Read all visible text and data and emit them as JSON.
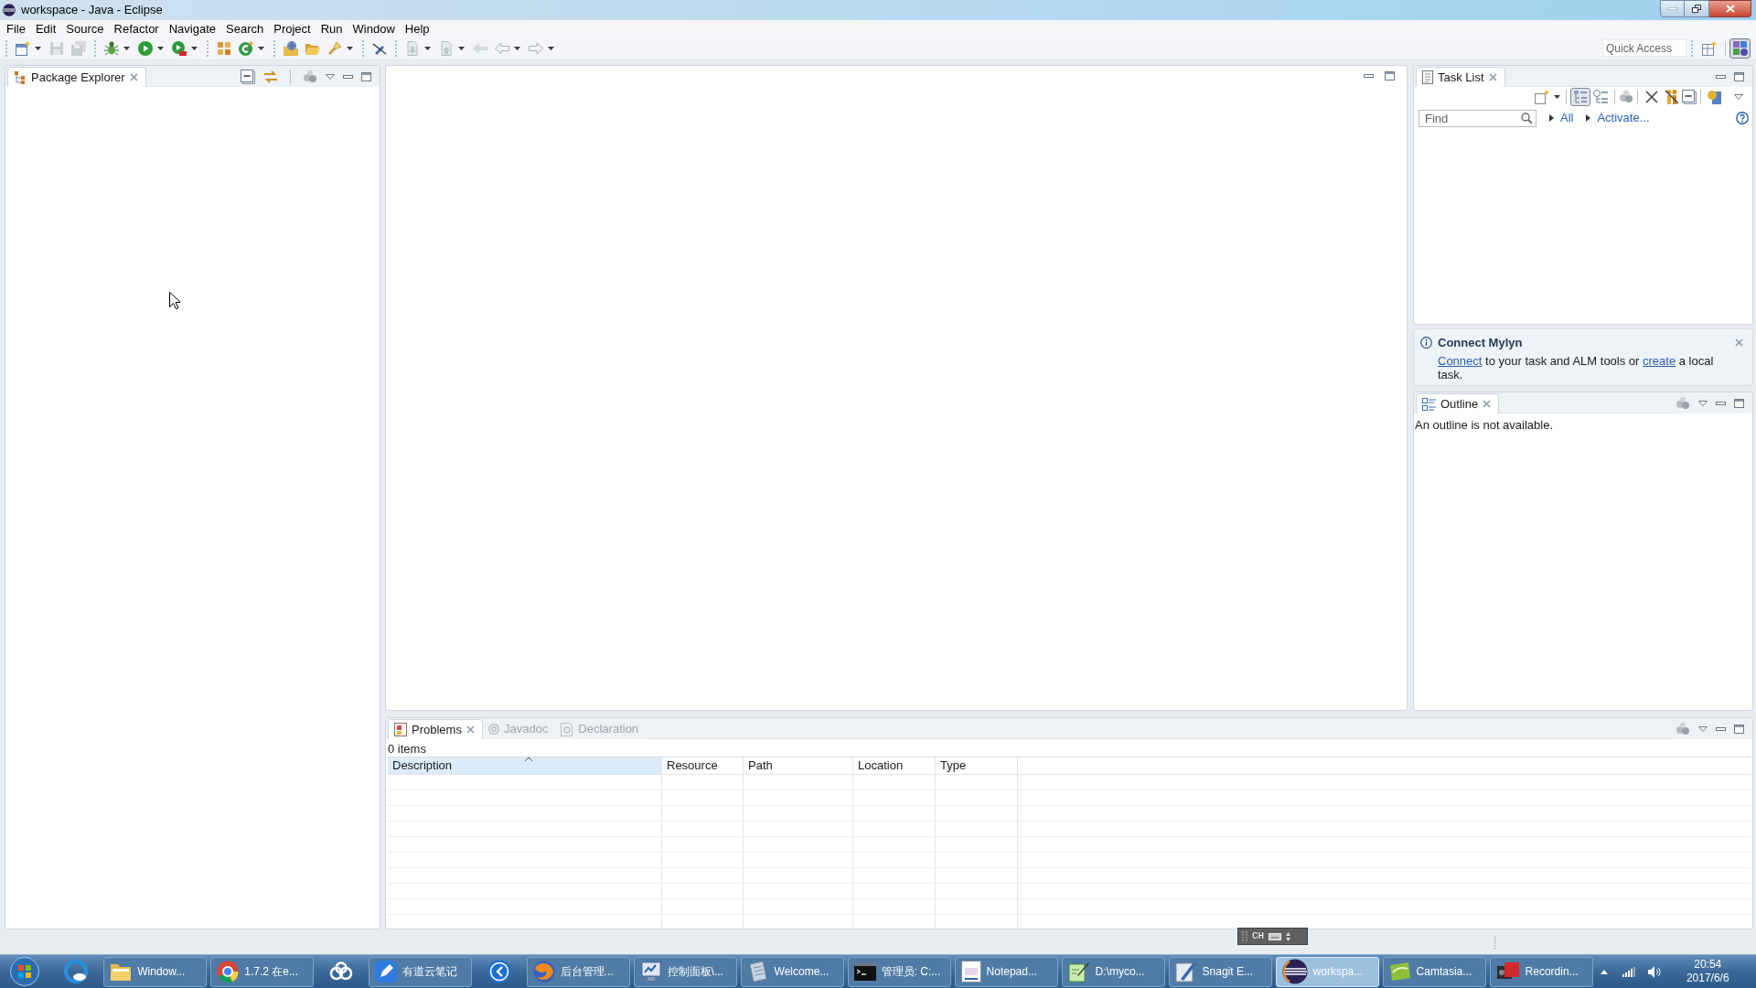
{
  "window": {
    "title": "workspace - Java - Eclipse"
  },
  "menu": [
    "File",
    "Edit",
    "Source",
    "Refactor",
    "Navigate",
    "Search",
    "Project",
    "Run",
    "Window",
    "Help"
  ],
  "quick_access": {
    "placeholder": "Quick Access"
  },
  "package_explorer": {
    "tab": {
      "label": "Package Explorer",
      "selected": true
    }
  },
  "task_list": {
    "tab": {
      "label": "Task List",
      "selected": true
    },
    "find": {
      "placeholder": "Find"
    },
    "filters": [
      "All",
      "Activate..."
    ]
  },
  "connect_mylyn": {
    "title": "Connect Mylyn",
    "message": [
      {
        "kind": "link",
        "text": "Connect"
      },
      {
        "kind": "text",
        "text": " to your task and ALM tools or "
      },
      {
        "kind": "link",
        "text": "create"
      },
      {
        "kind": "text",
        "text": " a local task."
      }
    ]
  },
  "outline": {
    "tab": {
      "label": "Outline",
      "selected": true
    },
    "message": "An outline is not available."
  },
  "bottom_panel": {
    "tabs": [
      {
        "label": "Problems",
        "selected": true
      },
      {
        "label": "Javadoc",
        "selected": false
      },
      {
        "label": "Declaration",
        "selected": false
      }
    ],
    "summary": "0 items",
    "columns": [
      {
        "label": "Description",
        "sorted": true
      },
      {
        "label": "Resource",
        "sorted": false
      },
      {
        "label": "Path",
        "sorted": false
      },
      {
        "label": "Location",
        "sorted": false
      },
      {
        "label": "Type",
        "sorted": false
      }
    ]
  },
  "ime": {
    "label": "CH"
  },
  "taskbar": {
    "items": [
      {
        "kind": "pinned",
        "selected": false
      },
      {
        "kind": "window",
        "label": "Window...",
        "selected": false
      },
      {
        "kind": "window",
        "label": "1.7.2 在e...",
        "selected": false
      },
      {
        "kind": "pinned",
        "selected": false
      },
      {
        "kind": "window",
        "label": "有道云笔记",
        "selected": false
      },
      {
        "kind": "pinned",
        "selected": false
      },
      {
        "kind": "window",
        "label": "后台管理...",
        "selected": false
      },
      {
        "kind": "window",
        "label": "控制面板\\...",
        "selected": false
      },
      {
        "kind": "window",
        "label": "Welcome...",
        "selected": false
      },
      {
        "kind": "window",
        "label": "管理员: C:...",
        "selected": false
      },
      {
        "kind": "window",
        "label": "Notepad...",
        "selected": false
      },
      {
        "kind": "window",
        "label": "D:\\myco...",
        "selected": false
      },
      {
        "kind": "window",
        "label": "Snagit E...",
        "selected": false
      },
      {
        "kind": "window",
        "label": "workspa...",
        "selected": true
      },
      {
        "kind": "window",
        "label": "Camtasia...",
        "selected": false
      },
      {
        "kind": "window",
        "label": "Recordin...",
        "selected": false
      }
    ],
    "clock": {
      "time": "20:54",
      "date": "2017/6/6"
    }
  }
}
